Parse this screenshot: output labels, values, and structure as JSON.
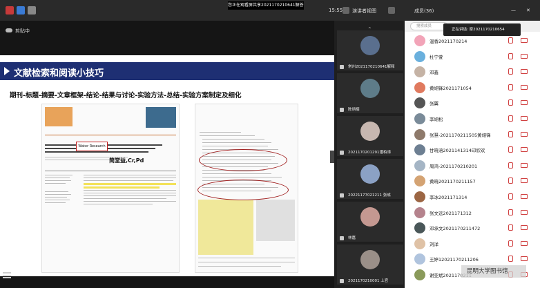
{
  "topbar": {
    "banner": "您正在观看屏共享2021170210641解答员",
    "timer": "15:55",
    "view_mode": "演讲者视图",
    "member_count": "成员(36)"
  },
  "share": {
    "label": "剪贴中",
    "slide_title": "文献检索和阅读小技巧",
    "slide_subtitle": "期刊-标题-摘要-文章框架-结论-结果与讨论-实验方法-总结-实验方案制定及细化",
    "journal_name": "Water Research",
    "author_cn": "简堂益,Cr,Pd"
  },
  "videos": [
    {
      "name": "常州2021170210641解释",
      "color": "#5a6f8e"
    },
    {
      "name": "陈炳楠",
      "color": "#5e7c89"
    },
    {
      "name": "2021170201291潘柏涛",
      "color": "#c7b7b0"
    },
    {
      "name": "20221177021211 张成",
      "color": "#8ba1c4"
    },
    {
      "name": "林嘉",
      "color": "#c49891"
    },
    {
      "name": "2021170210001 上官",
      "color": "#9a8f88"
    }
  ],
  "panel": {
    "search_placeholder": "搜索成员",
    "speaker_tip": "正在讲话: 原2021170210654",
    "members": [
      {
        "name": "温香2021170214",
        "color": "#f2a4b8"
      },
      {
        "name": "杜宁萱",
        "color": "#6ab0dd"
      },
      {
        "name": "邓鑫",
        "color": "#c5b3a5"
      },
      {
        "name": "黄翊锋2021171054",
        "color": "#e07a5f"
      },
      {
        "name": "张翼",
        "color": "#555555"
      },
      {
        "name": "李翊松",
        "color": "#7a8b99"
      },
      {
        "name": "张慧-2021170211505黄翊锋",
        "color": "#8e7a6b"
      },
      {
        "name": "甘晓涵2021141314印欣欢",
        "color": "#6d7f92"
      },
      {
        "name": "周鸿-2021170210201",
        "color": "#a5b5c5"
      },
      {
        "name": "黄晓2021170211157",
        "color": "#d4a373"
      },
      {
        "name": "李冰2021171314",
        "color": "#9c6644"
      },
      {
        "name": "张文远2021171312",
        "color": "#b5838d"
      },
      {
        "name": "邓承文2021170211472",
        "color": "#4a5759"
      },
      {
        "name": "刘洋",
        "color": "#dfc2a6"
      },
      {
        "name": "王婷12021170211206",
        "color": "#b0c4de"
      },
      {
        "name": "谢亚斌2021170211",
        "color": "#8a9a5b"
      }
    ]
  },
  "watermark": "昆明大学图书馆"
}
